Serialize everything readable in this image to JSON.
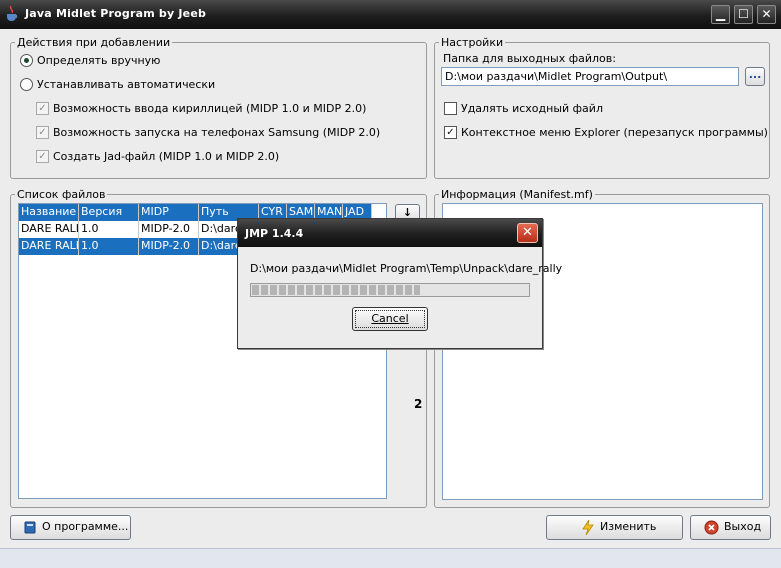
{
  "window": {
    "title": "Java Midlet Program by Jeeb",
    "controls": {
      "minimize": "▁",
      "maximize": "☐",
      "close": "✕"
    }
  },
  "add_options": {
    "legend": "Действия при добавлении",
    "radio_manual": {
      "label": "Определять вручную",
      "checked": true
    },
    "radio_auto": {
      "label": "Устанавливать автоматически",
      "checked": false
    },
    "checkboxes": [
      {
        "label": "Возможность ввода кириллицей (MIDP 1.0 и MIDP 2.0)",
        "checked": true
      },
      {
        "label": "Возможность запуска на телефонах Samsung (MIDP 2.0)",
        "checked": true
      },
      {
        "label": "Создать Jad-файл (MIDP 1.0 и MIDP 2.0)",
        "checked": true
      }
    ]
  },
  "settings": {
    "legend": "Настройки",
    "output_folder_label": "Папка для выходных файлов:",
    "output_folder_value": "D:\\мои раздачи\\Midlet Program\\Output\\",
    "browse_label": "...",
    "delete_source_label": "Удалять исходный файл",
    "delete_source_checked": false,
    "context_menu_label": "Контекстное меню Explorer (перезапуск программы)",
    "context_menu_checked": true
  },
  "file_list": {
    "legend": "Список файлов",
    "columns": [
      "Название",
      "Версия",
      "MIDP",
      "Путь",
      "CYR",
      "SAM",
      "MAN",
      "JAD"
    ],
    "rows": [
      [
        "DARE RALLY",
        "1.0",
        "MIDP-2.0",
        "D:\\dare",
        "",
        "",
        "",
        ""
      ],
      [
        "DARE RALLY",
        "1.0",
        "MIDP-2.0",
        "D:\\dare",
        "",
        "",
        "",
        ""
      ]
    ],
    "side_button_label": "↓",
    "count_label": "2"
  },
  "manifest": {
    "legend": "Информация (Manifest.mf)",
    "content": ""
  },
  "dialog": {
    "title": "JMP 1.4.4",
    "path": "D:\\мои раздачи\\Midlet Program\\Temp\\Unpack\\dare_rally",
    "progress": 0.61,
    "cancel_label": "Cancel",
    "close_label": "✕"
  },
  "footer": {
    "about_label": "О программе...",
    "change_label": "Изменить",
    "exit_label": "Выход"
  },
  "colors": {
    "title_bar": "#1e1e1e",
    "selection": "#1b6fbf",
    "close_red": "#d0442c"
  }
}
